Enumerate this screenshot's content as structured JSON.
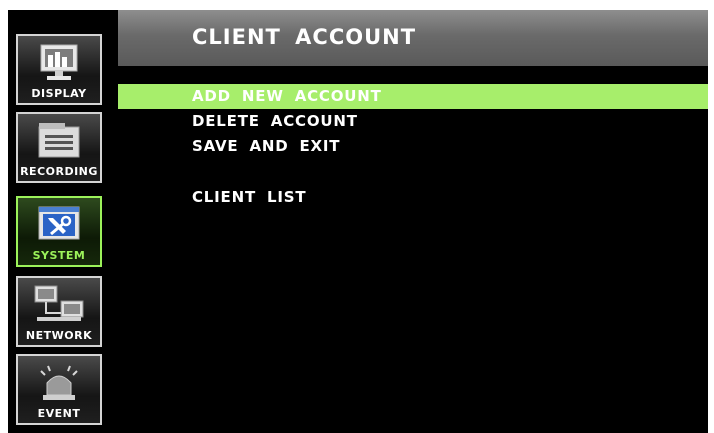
{
  "sidebar": {
    "items": [
      {
        "label": "DISPLAY",
        "icon": "monitor-icon"
      },
      {
        "label": "RECORDING",
        "icon": "recorder-icon"
      },
      {
        "label": "SYSTEM",
        "icon": "system-tools-icon",
        "active": true
      },
      {
        "label": "NETWORK",
        "icon": "network-icon"
      },
      {
        "label": "EVENT",
        "icon": "alarm-light-icon"
      }
    ]
  },
  "header": {
    "title": "CLIENT ACCOUNT"
  },
  "menu": {
    "items": [
      {
        "label": "ADD NEW ACCOUNT",
        "selected": true
      },
      {
        "label": "DELETE ACCOUNT"
      },
      {
        "label": "SAVE AND EXIT"
      },
      {
        "label": "CLIENT LIST"
      }
    ]
  },
  "colors": {
    "highlight": "#a7ee6b",
    "active_border": "#9cf25a",
    "title_bar": "#6a6a6a",
    "background": "#000000"
  }
}
